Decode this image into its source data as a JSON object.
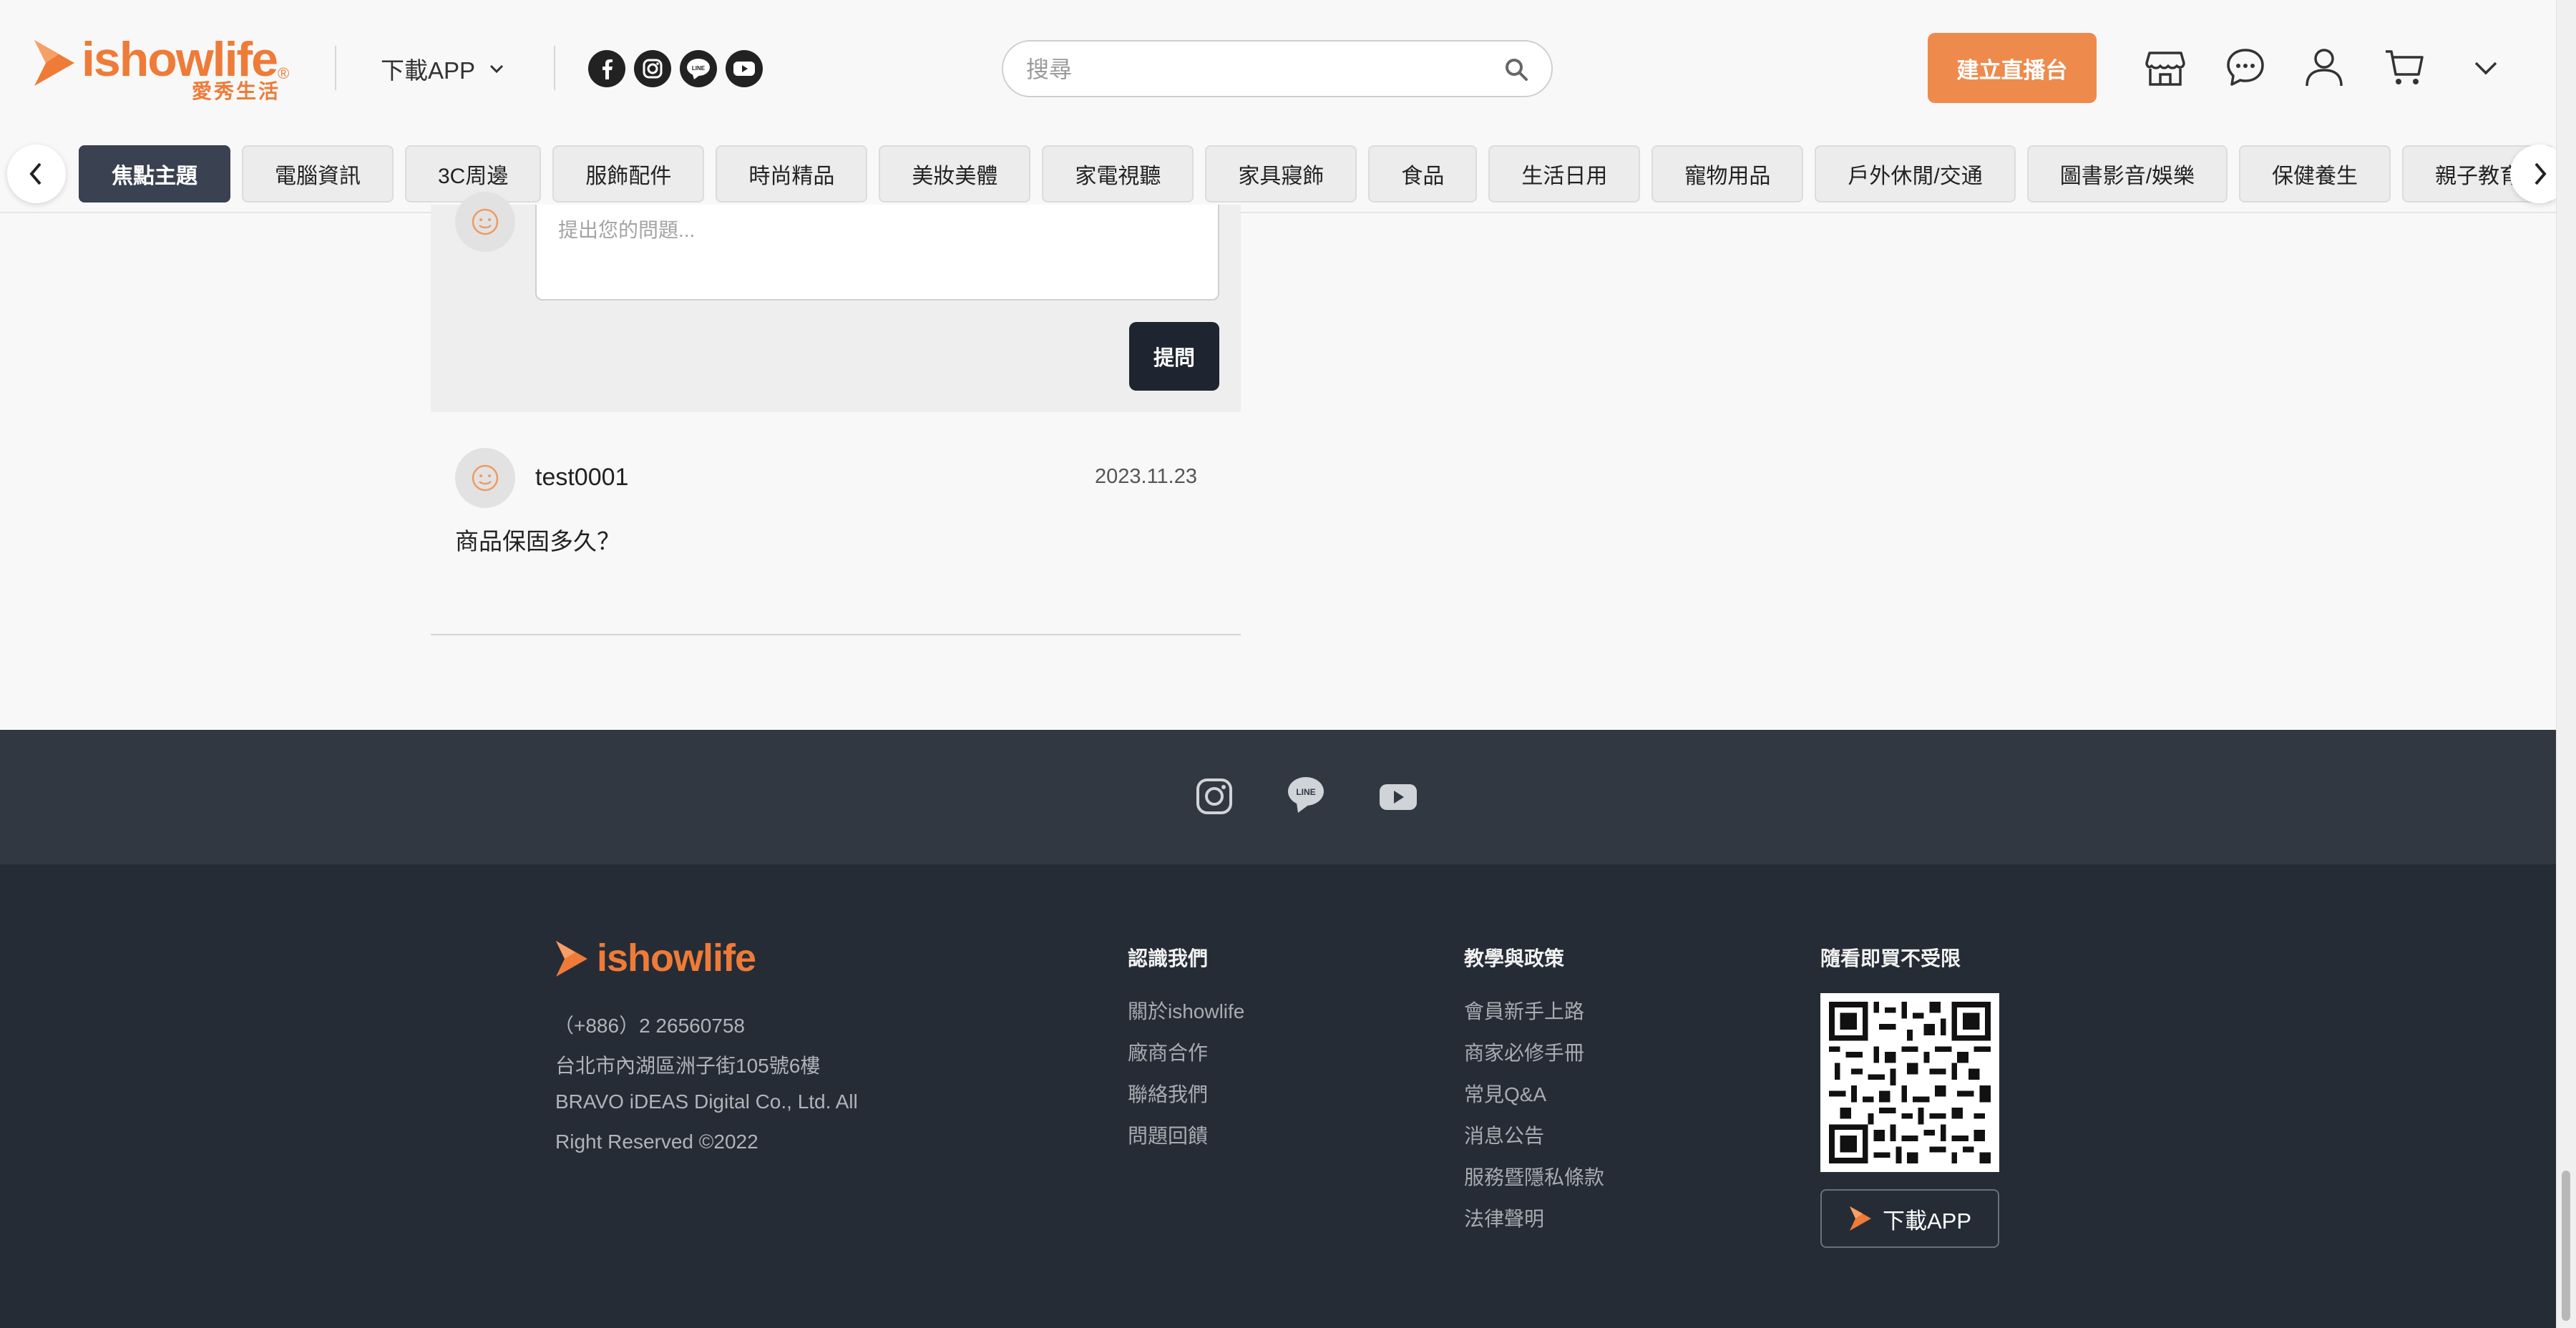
{
  "header": {
    "logo_text": "ishowlife",
    "logo_sub": "愛秀生活",
    "logo_reg": "®",
    "download_app": "下載APP",
    "search_placeholder": "搜尋",
    "create_live_button": "建立直播台",
    "social": {
      "line_text": "LINE"
    }
  },
  "categories": [
    "焦點主題",
    "電腦資訊",
    "3C周邊",
    "服飾配件",
    "時尚精品",
    "美妝美體",
    "家電視聽",
    "家具寢飾",
    "食品",
    "生活日用",
    "寵物用品",
    "戶外休閒/交通",
    "圖書影音/娛樂",
    "保健養生",
    "親子教育"
  ],
  "question_form": {
    "placeholder": "提出您的問題...",
    "submit_label": "提問"
  },
  "comment": {
    "user": "test0001",
    "date": "2023.11.23",
    "body": "商品保固多久？"
  },
  "footer": {
    "logo_text": "ishowlife",
    "phone": "（+886）2 26560758",
    "address": "台北市內湖區洲子街105號6樓",
    "company_line1": "BRAVO iDEAS Digital Co., Ltd. All",
    "company_line2": "Right Reserved ©2022",
    "col_about": {
      "title": "認識我們",
      "links": [
        "關於ishowlife",
        "廠商合作",
        "聯絡我們",
        "問題回饋"
      ]
    },
    "col_policy": {
      "title": "教學與政策",
      "links": [
        "會員新手上路",
        "商家必修手冊",
        "常見Q&A",
        "消息公告",
        "服務暨隱私條款",
        "法律聲明"
      ]
    },
    "col_app": {
      "title": "隨看即買不受限",
      "download_label": "下載APP"
    },
    "line_text": "LINE"
  },
  "colors": {
    "brand_orange": "#ee7b38",
    "active_tab": "#3a4150",
    "footer_dark": "#262c35",
    "footer_top": "#323842"
  }
}
